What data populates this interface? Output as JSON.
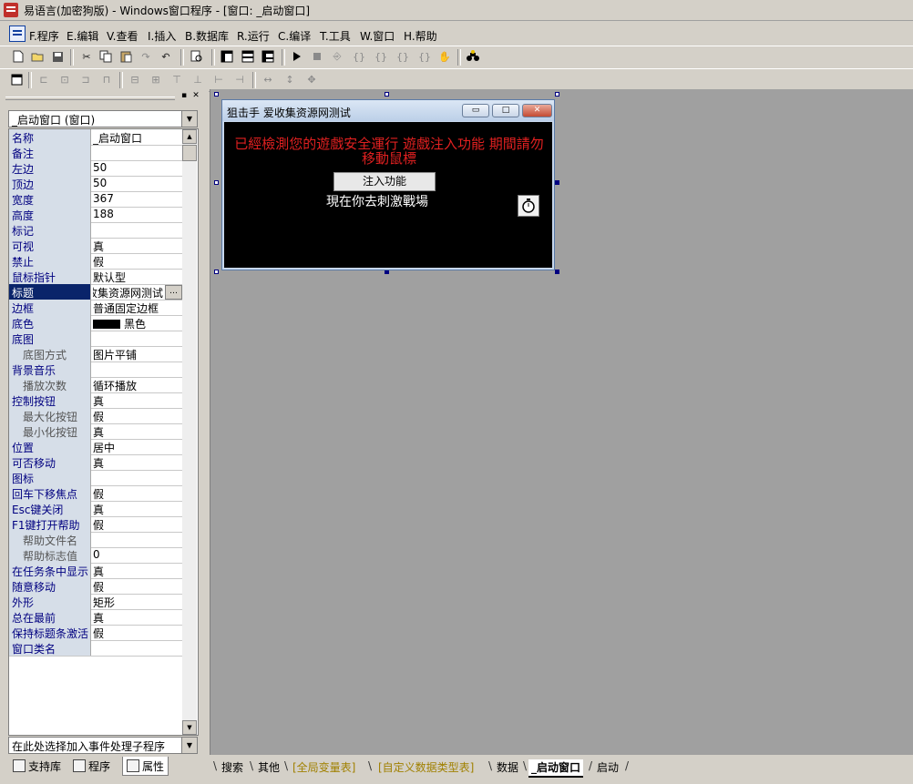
{
  "window": {
    "title": "易语言(加密狗版) - Windows窗口程序 - [窗口: _启动窗口]"
  },
  "menu": [
    "F.程序",
    "E.编辑",
    "V.查看",
    "I.插入",
    "B.数据库",
    "R.运行",
    "C.编译",
    "T.工具",
    "W.窗口",
    "H.帮助"
  ],
  "panel": {
    "object_selector": "_启动窗口 (窗口)",
    "event_selector": "在此处选择加入事件处理子程序",
    "properties": [
      {
        "name": "名称",
        "value": "_启动窗口"
      },
      {
        "name": "备注",
        "value": ""
      },
      {
        "name": "左边",
        "value": "50"
      },
      {
        "name": "顶边",
        "value": "50"
      },
      {
        "name": "宽度",
        "value": "367"
      },
      {
        "name": "高度",
        "value": "188"
      },
      {
        "name": "标记",
        "value": ""
      },
      {
        "name": "可视",
        "value": "真"
      },
      {
        "name": "禁止",
        "value": "假"
      },
      {
        "name": "鼠标指针",
        "value": "默认型"
      },
      {
        "name": "标题",
        "value": "收集资源网测试"
      },
      {
        "name": "边框",
        "value": "普通固定边框"
      },
      {
        "name": "底色",
        "value": "黑色"
      },
      {
        "name": "底图",
        "value": ""
      },
      {
        "name": "底图方式",
        "value": "图片平铺"
      },
      {
        "name": "背景音乐",
        "value": ""
      },
      {
        "name": "播放次数",
        "value": "循环播放"
      },
      {
        "name": "控制按钮",
        "value": "真"
      },
      {
        "name": "最大化按钮",
        "value": "假"
      },
      {
        "name": "最小化按钮",
        "value": "真"
      },
      {
        "name": "位置",
        "value": "居中"
      },
      {
        "name": "可否移动",
        "value": "真"
      },
      {
        "name": "图标",
        "value": ""
      },
      {
        "name": "回车下移焦点",
        "value": "假"
      },
      {
        "name": "Esc键关闭",
        "value": "真"
      },
      {
        "name": "F1键打开帮助",
        "value": "假"
      },
      {
        "name": "帮助文件名",
        "value": ""
      },
      {
        "name": "帮助标志值",
        "value": "0"
      },
      {
        "name": "在任务条中显示",
        "value": "真"
      },
      {
        "name": "随意移动",
        "value": "假"
      },
      {
        "name": "外形",
        "value": "矩形"
      },
      {
        "name": "总在最前",
        "value": "真"
      },
      {
        "name": "保持标题条激活",
        "value": "假"
      },
      {
        "name": "窗口类名",
        "value": ""
      }
    ],
    "tabs": [
      "支持库",
      "程序",
      "属性"
    ]
  },
  "form": {
    "title": "狙击手 爱收集资源网测试",
    "red_text": "已經檢測您的遊戲安全運行 遊戲注入功能 期間請勿移動鼠標",
    "button_label": "注入功能",
    "white_text": "現在你去刺激戰場",
    "min_glyph": "▭",
    "max_glyph": "□",
    "close_glyph": "✕"
  },
  "bottom_tabs": [
    "搜索",
    "其他",
    "[全局变量表]",
    "[自定义数据类型表]",
    "数据",
    "_启动窗口",
    "启动"
  ],
  "colors": {
    "selection": "#0a246a",
    "design_bg": "#a0a0a0",
    "red_text": "#e02020"
  },
  "icons": {
    "toolbar1": [
      "new-file-icon",
      "open-folder-icon",
      "save-icon",
      "cut-icon",
      "copy-icon",
      "paste-icon",
      "redo-icon",
      "undo-icon",
      "find-icon",
      "layout-left-icon",
      "layout-top-icon",
      "layout-both-icon",
      "run-icon",
      "stop-icon",
      "step-icon",
      "step-into-icon",
      "step-over-icon",
      "step-out-icon",
      "run-to-cursor-icon",
      "breakpoint-hand-icon",
      "search-binoculars-icon"
    ],
    "toolbar2": [
      "form-icon",
      "align-left-icon",
      "align-center-icon",
      "align-right-icon",
      "align-top-icon",
      "center-h-icon",
      "center-v-icon",
      "same-width-icon",
      "same-height-icon",
      "same-size-icon",
      "space-h-icon",
      "space-v-icon",
      "center-form-icon"
    ]
  }
}
